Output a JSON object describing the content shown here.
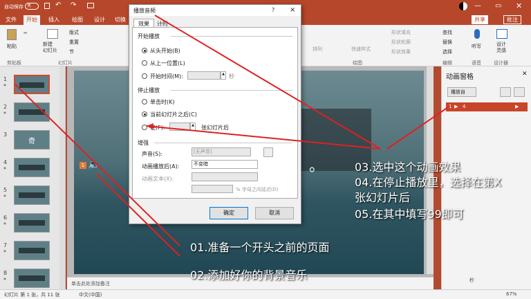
{
  "titlebar": {
    "autosave": "自动保存",
    "toggle": "关",
    "icons": [
      "save-icon",
      "undo-icon",
      "redo-icon",
      "present-icon"
    ]
  },
  "ribbon": {
    "tabs": [
      "文件",
      "开始",
      "插入",
      "绘图",
      "设计",
      "切换"
    ],
    "active_tab": "开始",
    "share": "共享",
    "comments": "批注",
    "paste": "粘贴",
    "new_slide": "新建\n幻灯片",
    "layout": "版式",
    "reset": "重置",
    "section": "节",
    "clipboard": "剪贴板",
    "slides": "幻灯片",
    "drawing": "绘图",
    "quick_styles": "快速样式",
    "arrange": "排列",
    "shape_fill": "形状填充",
    "shape_outline": "形状轮廓",
    "shape_effects": "形状效果",
    "find": "查找",
    "replace": "替换",
    "select": "选择",
    "editing": "编辑",
    "dictate": "听写",
    "voice": "语音",
    "design_ideas": "设计\n灵感",
    "designer": "设计器"
  },
  "thumbnails": [
    {
      "num": "1",
      "star": "*"
    },
    {
      "num": "2",
      "star": "*"
    },
    {
      "num": "3",
      "star": "",
      "text": "奇"
    },
    {
      "num": "4",
      "star": "*"
    },
    {
      "num": "5",
      "star": "*"
    },
    {
      "num": "6",
      "star": "*"
    },
    {
      "num": "7",
      "star": "*"
    },
    {
      "num": "8",
      "star": "*"
    }
  ],
  "slide": {
    "trailing_text": "。",
    "anim_tag": "1"
  },
  "notes_placeholder": "单击此处添加备注",
  "statusbar": {
    "slide_info": "幻灯片 第 1 张，共 11 张",
    "language": "中文(中国)",
    "zoom": "67%"
  },
  "anim_pane": {
    "title": "动画窗格",
    "play_button": "播放自",
    "item_number": "1",
    "item_label": "4",
    "seconds": "秒"
  },
  "dialog": {
    "title": "播放音频",
    "help": "?",
    "close": "×",
    "tabs": [
      "效果",
      "计时"
    ],
    "start_section": "开始播放",
    "start_options": [
      "从头开始(B)",
      "从上一位置(L)",
      "开始时间(M):"
    ],
    "start_seconds_suffix": "秒",
    "stop_section": "停止播放",
    "stop_options": [
      "单击时(K)",
      "当前幻灯片之后(C)",
      "在(F):"
    ],
    "stop_after_suffix": "张幻灯片后",
    "enhance_section": "增强",
    "sound_label": "声音(S):",
    "sound_value": "[无声音]",
    "after_anim_label": "动画播放后(A):",
    "after_anim_value": "不变暗",
    "anim_text_label": "动画文本(X):",
    "delay_suffix": "% 字母之间延迟(D)",
    "ok": "确定",
    "cancel": "取消"
  },
  "annotations": {
    "a1": "01.准备一个开头之前的页面",
    "a2": "02.添加好你的背景音乐",
    "a3": "03.选中这个动画效果",
    "a4": "04.在停止播放里，选择在第X",
    "a4b": "张幻灯片后",
    "a5": "05.在其中填写99即可"
  },
  "colors": {
    "brand": "#b7472a",
    "arrow": "#e02020",
    "anim_item": "#c9452a"
  }
}
